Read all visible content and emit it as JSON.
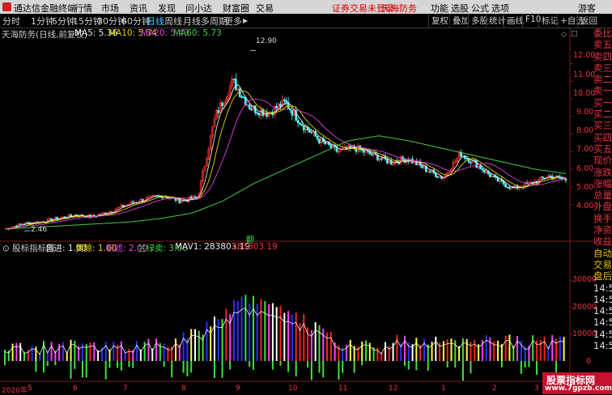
{
  "app_title": "通达信金融终端",
  "menu": [
    "行情",
    "市场",
    "资讯",
    "发现",
    "问小达",
    "财富圈",
    "交易"
  ],
  "notice": "证券交易未登录",
  "stock_name_header": "天海防务",
  "top_right": [
    "功能",
    "选股",
    "公式",
    "选项",
    "游客"
  ],
  "period_tabs": [
    "分时",
    "1分钟",
    "5分钟",
    "15分钟",
    "30分钟",
    "60分钟",
    "日线",
    "周线",
    "月线",
    "多周期",
    "更多"
  ],
  "selected_period": "日线",
  "toolbar_right": [
    "复权",
    "叠加",
    "多股",
    "统计",
    "画线",
    "F10",
    "标记",
    "+自选",
    "返回"
  ],
  "title": "天海防务(日线,前复权)",
  "ma": {
    "ma5": "MA5: 5.36",
    "ma10": "MA10: 5.34",
    "ma20": "MA20: 5.43",
    "ma60": "MA60: 5.73"
  },
  "ma_colors": {
    "ma5": "#e8e8e8",
    "ma10": "#e8d400",
    "ma20": "#e040e0",
    "ma60": "#40d040"
  },
  "price_annotations": {
    "high": "12.90",
    "low": "2.46",
    "mark": "翻"
  },
  "price_axis": [
    "12.00",
    "11.00",
    "10.00",
    "9.00",
    "8.00",
    "7.00",
    "6.00",
    "5.00",
    "4.00"
  ],
  "indicator": {
    "name": "股标指标网",
    "zijin": "自进: 1.00",
    "huangjing": "黄鲸: 1.00",
    "fenzhe": "粉遮: 2.00",
    "lanlv": "兰绿卖: 3.00",
    "mav1": "MAV1: 283803.19",
    "last": "283803.19"
  },
  "vol_axis": [
    "30000",
    "20000",
    "10000",
    "0"
  ],
  "right_panel": [
    "委比",
    "卖五",
    "卖四",
    "卖三",
    "卖二",
    "卖一",
    "买一",
    "买二",
    "买三",
    "买四",
    "买五",
    "现价",
    "涨跌",
    "涨幅",
    "总量",
    "外盘",
    "换手",
    "净资",
    "收益",
    "自动",
    "交易",
    "盘后",
    "14:56",
    "14:56",
    "14:56",
    "14:56",
    "14:56",
    "14:56"
  ],
  "date_axis": [
    "2020年",
    "5",
    "6",
    "7",
    "8",
    "9",
    "10",
    "11",
    "12",
    "1",
    "2",
    "3"
  ],
  "watermark": {
    "line1": "股票指标网",
    "line2": "www.7gpzb.com"
  },
  "chart_data": {
    "type": "candlestick",
    "note": "daily k-line with MA lines and indicator histogram",
    "price_ylim": [
      2.0,
      13.5
    ],
    "ma60": [
      2.6,
      2.7,
      2.8,
      2.9,
      3.0,
      3.2,
      3.5,
      4.2,
      5.2,
      6.0,
      6.8,
      7.6,
      7.9,
      7.6,
      7.2,
      6.8,
      6.4,
      6.0,
      5.75
    ],
    "close_path": [
      2.6,
      2.9,
      3.0,
      3.2,
      3.4,
      3.3,
      3.6,
      4.0,
      4.3,
      4.5,
      4.2,
      4.4,
      9.0,
      11.0,
      9.5,
      9.2,
      9.8,
      8.5,
      7.6,
      7.0,
      7.2,
      6.8,
      6.4,
      6.6,
      6.0,
      5.5,
      6.9,
      6.2,
      5.4,
      4.9,
      5.2,
      5.6,
      5.4
    ]
  }
}
